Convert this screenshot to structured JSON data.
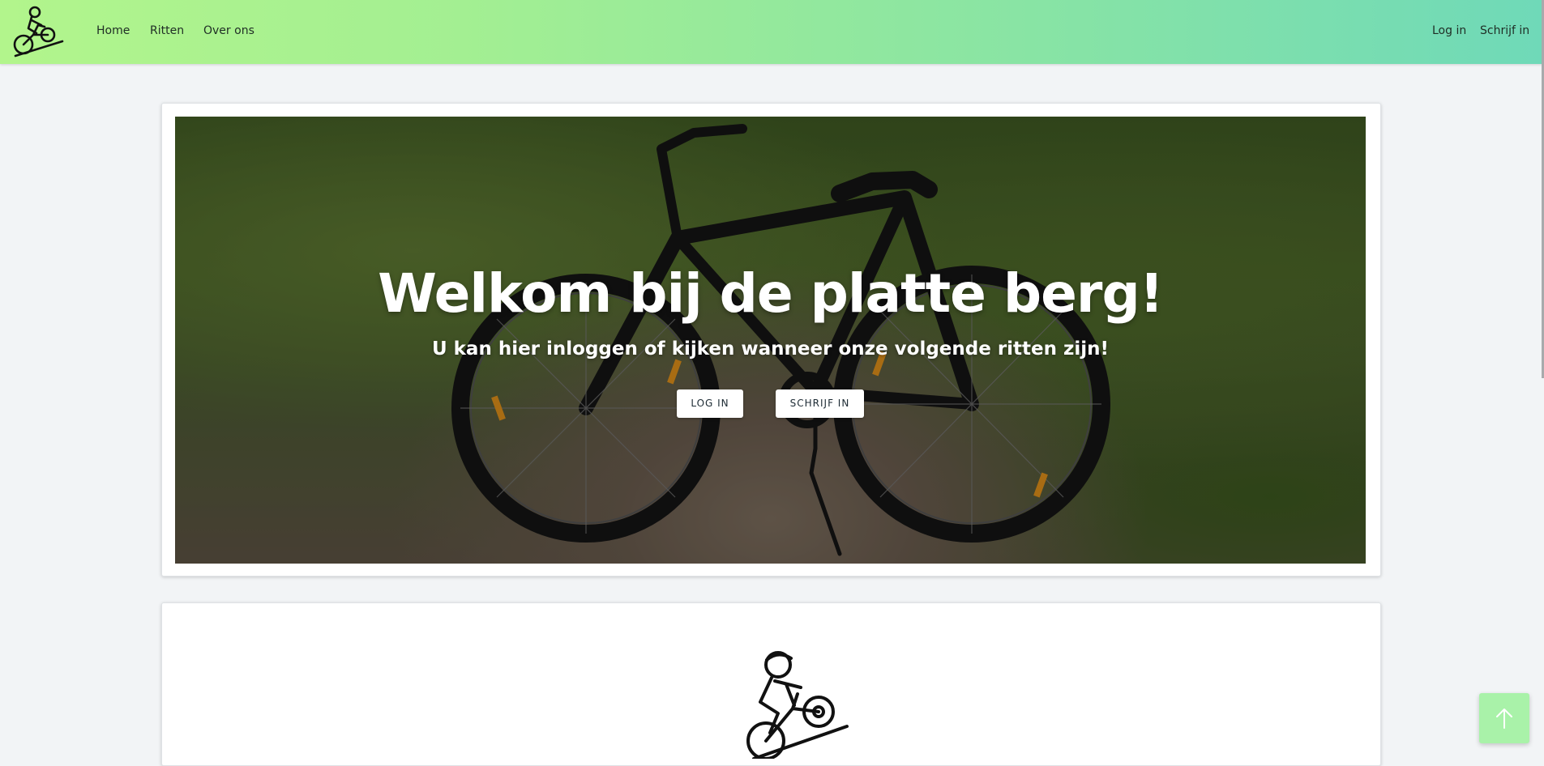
{
  "nav": {
    "links": [
      "Home",
      "Ritten",
      "Over ons"
    ],
    "auth": [
      "Log in",
      "Schrijf in"
    ]
  },
  "hero": {
    "title": "Welkom bij de platte berg!",
    "subtitle": "U kan hier inloggen of kijken wanneer onze volgende ritten zijn!",
    "buttons": [
      "LOG IN",
      "SCHRIJF IN"
    ]
  },
  "icons": {
    "logo": "cyclist-uphill-icon",
    "scroll_top": "arrow-up-icon"
  }
}
